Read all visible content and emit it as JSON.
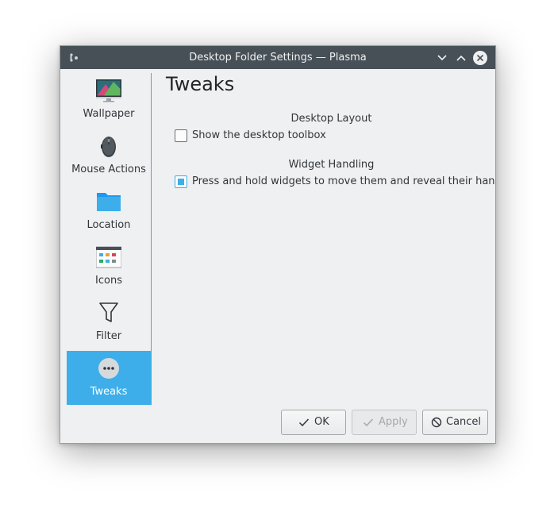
{
  "window": {
    "title": "Desktop Folder Settings — Plasma"
  },
  "sidebar": {
    "items": [
      {
        "label": "Wallpaper",
        "icon": "wallpaper-icon"
      },
      {
        "label": "Mouse Actions",
        "icon": "mouse-icon"
      },
      {
        "label": "Location",
        "icon": "folder-icon"
      },
      {
        "label": "Icons",
        "icon": "icons-icon"
      },
      {
        "label": "Filter",
        "icon": "filter-icon"
      },
      {
        "label": "Tweaks",
        "icon": "more-icon",
        "active": true
      }
    ]
  },
  "main": {
    "title": "Tweaks",
    "sections": [
      {
        "title": "Desktop Layout",
        "options": [
          {
            "label": "Show the desktop toolbox",
            "checked": false
          }
        ]
      },
      {
        "title": "Widget Handling",
        "options": [
          {
            "label": "Press and hold widgets to move them and reveal their handle",
            "checked": true
          }
        ]
      }
    ]
  },
  "buttons": {
    "ok": "OK",
    "apply": "Apply",
    "cancel": "Cancel"
  },
  "colors": {
    "accent": "#3daee9",
    "titlebar": "#475057",
    "window_bg": "#eff0f1"
  }
}
